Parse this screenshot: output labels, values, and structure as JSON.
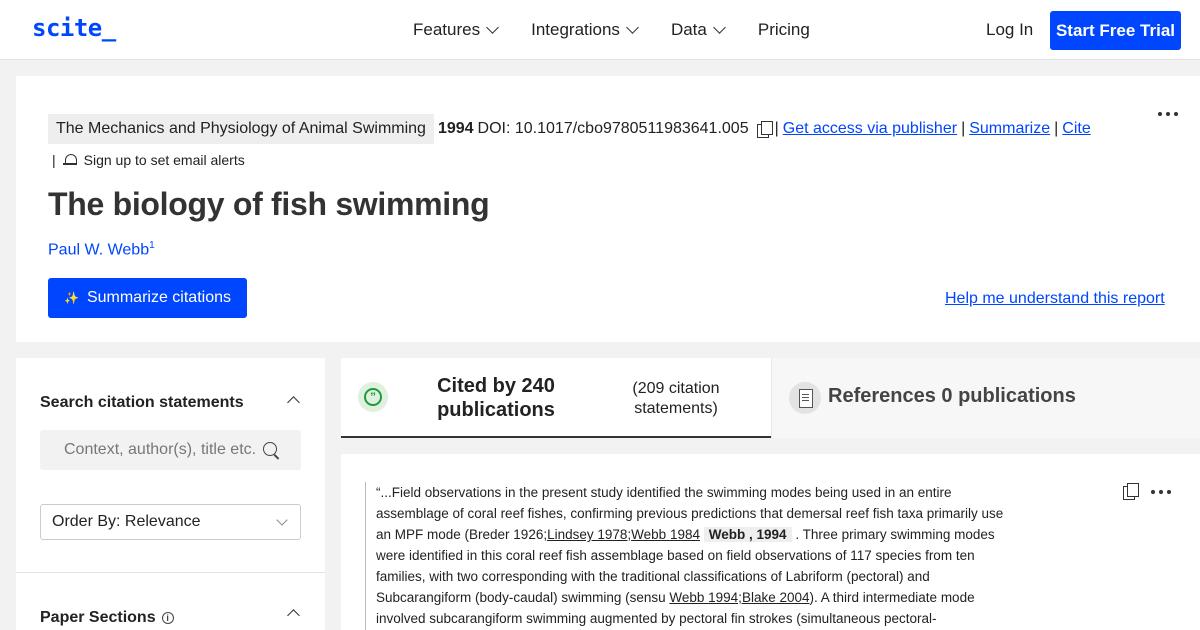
{
  "nav": {
    "logo": "scite_",
    "menu": [
      "Features",
      "Integrations",
      "Data",
      "Pricing"
    ],
    "login": "Log In",
    "trial": "Start Free Trial"
  },
  "header": {
    "journal": "The Mechanics and Physiology of Animal Swimming",
    "year": "1994",
    "doi": "DOI: 10.1017/cbo9780511983641.005",
    "links": [
      "Get access via publisher",
      "Summarize",
      "Cite"
    ],
    "sep": "|",
    "alerts": "Sign up to set email alerts",
    "title": "The biology of fish swimming",
    "author": "Paul W. Webb",
    "author_sup": "1",
    "summarize_button": "Summarize citations",
    "help_link": "Help me understand this report"
  },
  "sidebar": {
    "search_heading": "Search citation statements",
    "search_placeholder": "Context, author(s), title etc.",
    "order_by": "Order By: Relevance",
    "sections_heading": "Paper Sections"
  },
  "tabs": {
    "cited_label": "Cited by 240 publications",
    "cited_sub": "(209 citation statements)",
    "refs_label": "References 0 publications"
  },
  "citation": {
    "t1": "“...Field observations in the present study identified the swimming modes being used in an entire assemblage of coral reef fishes, confirming previous predictions that demersal reef fish taxa primarily use an MPF mode (Breder 1926;",
    "l1": "Lindsey 1978;",
    "l2": "Webb 1984",
    "hl": "Webb , 1994",
    "t2": ". Three primary swimming modes were identified in this coral reef fish assemblage based on field observations of 117 species from ten families, with two corresponding with the traditional classifications of Labriform (pectoral) and Subcarangiform (body-caudal) swimming (sensu ",
    "l3": "Webb 1994;",
    "l4": "Blake 2004",
    "t3": "). A third intermediate mode involved subcarangiform swimming augmented by pectoral fin strokes (simultaneous pectoral-"
  }
}
